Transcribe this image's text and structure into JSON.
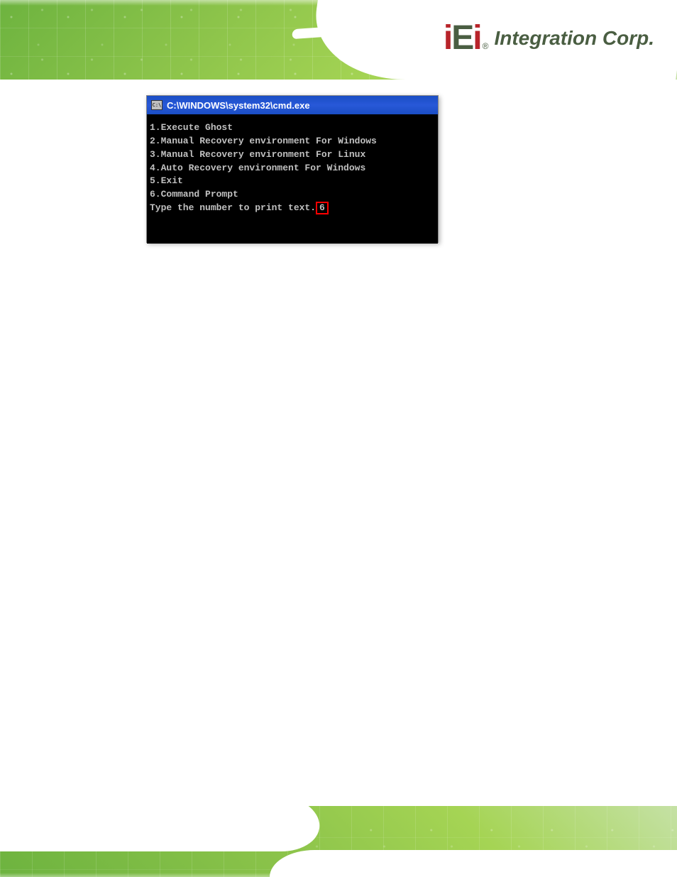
{
  "header": {
    "logo": {
      "brand_i1": "i",
      "brand_e": "E",
      "brand_i2": "i",
      "reg_mark": "®",
      "company_text": "Integration Corp."
    }
  },
  "cmd_window": {
    "icon_text": "C:\\",
    "title": "C:\\WINDOWS\\system32\\cmd.exe",
    "lines": [
      "1.Execute Ghost",
      "2.Manual Recovery environment For Windows",
      "3.Manual Recovery environment For Linux",
      "4.Auto Recovery environment For Windows",
      "5.Exit",
      "6.Command Prompt"
    ],
    "prompt_text": "Type the number to print text.",
    "input_value": "6"
  }
}
